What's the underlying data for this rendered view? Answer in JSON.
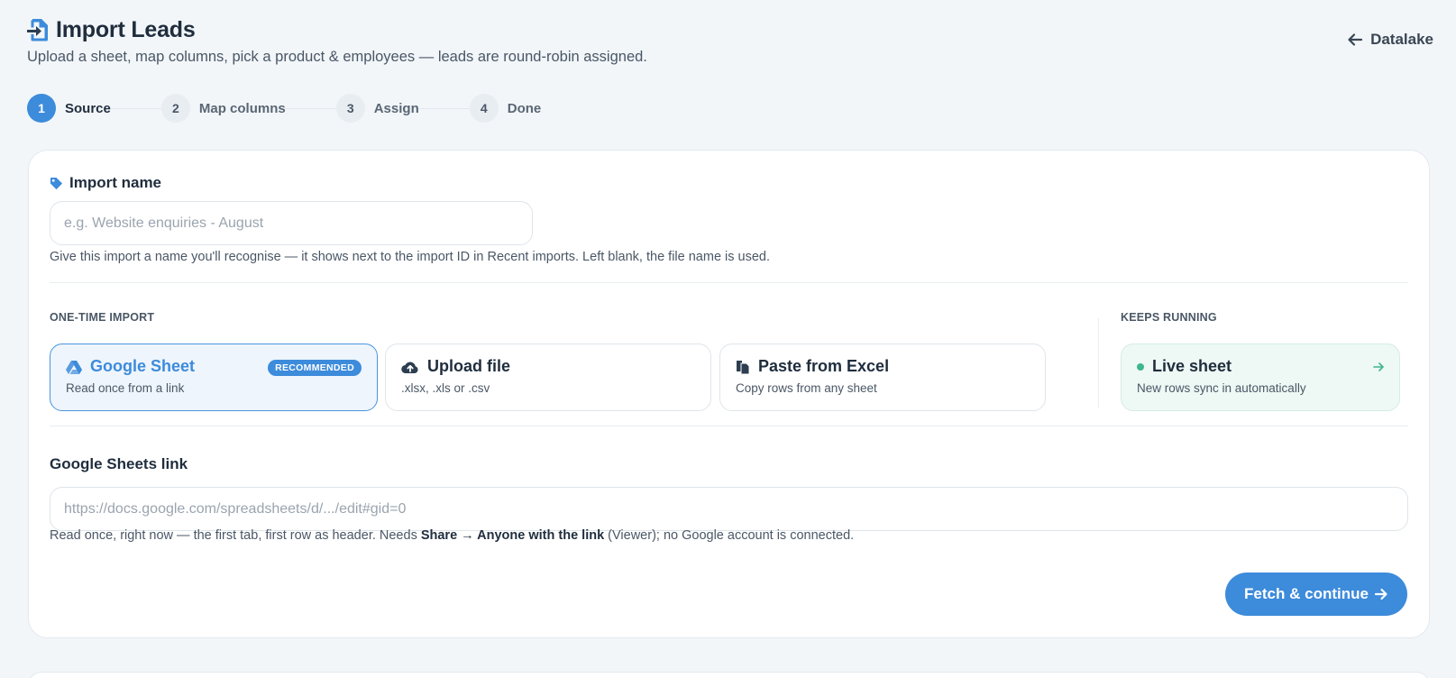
{
  "header": {
    "title": "Import Leads",
    "subtitle": "Upload a sheet, map columns, pick a product & employees — leads are round-robin assigned.",
    "back_label": "Datalake",
    "title_icon": "file-import-icon",
    "back_icon": "arrow-left-icon"
  },
  "steps": [
    {
      "num": "1",
      "label": "Source",
      "active": true
    },
    {
      "num": "2",
      "label": "Map columns",
      "active": false
    },
    {
      "num": "3",
      "label": "Assign",
      "active": false
    },
    {
      "num": "4",
      "label": "Done",
      "active": false
    }
  ],
  "import_name": {
    "label": "Import name",
    "placeholder": "e.g. Website enquiries - August",
    "value": "",
    "hint": "Give this import a name you'll recognise — it shows next to the import ID in Recent imports. Left blank, the file name is used."
  },
  "sources": {
    "one_time_label": "ONE-TIME IMPORT",
    "keeps_running_label": "KEEPS RUNNING",
    "options": [
      {
        "title": "Google Sheet",
        "sub": "Read once from a link",
        "icon": "google-drive-icon",
        "badge": "RECOMMENDED",
        "selected": true
      },
      {
        "title": "Upload file",
        "sub": ".xlsx, .xls or .csv",
        "icon": "cloud-upload-icon"
      },
      {
        "title": "Paste from Excel",
        "sub": "Copy rows from any sheet",
        "icon": "clipboard-icon"
      }
    ],
    "live": {
      "title": "Live sheet",
      "sub": "New rows sync in automatically",
      "icon": "arrow-right-icon"
    }
  },
  "sheet_link": {
    "label": "Google Sheets link",
    "placeholder": "https://docs.google.com/spreadsheets/d/.../edit#gid=0",
    "value": "",
    "hint_before": "Read once, right now — the first tab, first row as header. Needs ",
    "hint_bold": "Share → Anyone with the link",
    "hint_after": " (Viewer); no Google account is connected."
  },
  "actions": {
    "fetch_label": "Fetch & continue"
  },
  "colors": {
    "accent": "#3d8bdb",
    "live_green": "#3fb68b",
    "background": "#f2f6f9"
  }
}
